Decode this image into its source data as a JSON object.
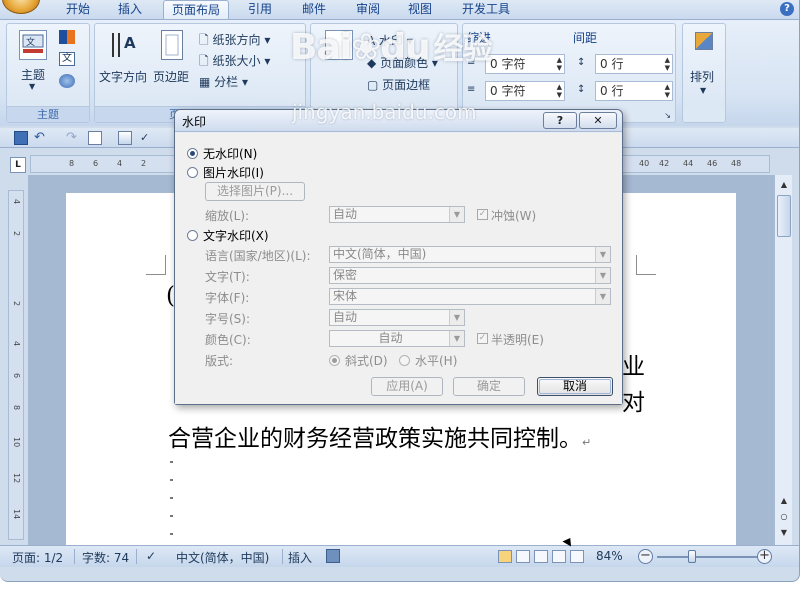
{
  "ribbon_tabs": [
    "开始",
    "插入",
    "页面布局",
    "引用",
    "邮件",
    "审阅",
    "视图",
    "开发工具"
  ],
  "active_tab": "页面布局",
  "theme_group": {
    "label": "主题",
    "theme_button": "主题"
  },
  "page_setup": {
    "text_direction": "文字方向",
    "margins": "页边距",
    "orientation": "纸张方向",
    "size": "纸张大小",
    "columns": "分栏",
    "group_label": "页"
  },
  "page_background": {
    "watermark": "水印",
    "page_color": "页面颜色",
    "page_border": "页面边框"
  },
  "paragraph": {
    "indent_title": "缩进",
    "spacing_title": "间距",
    "indent_left": "0 字符",
    "indent_right": "0 字符",
    "spacing_before": "0 行",
    "spacing_after": "0 行"
  },
  "arrange": {
    "label": "排列"
  },
  "ruler": {
    "h_numbers": [
      "8",
      "6",
      "4",
      "2",
      "40",
      "42",
      "44",
      "46",
      "48"
    ],
    "v_numbers": [
      "4",
      "2",
      "2",
      "4",
      "6",
      "8",
      "10",
      "12",
      "14"
    ],
    "corner": "L"
  },
  "document": {
    "line1_char": "业",
    "line2_char": "对",
    "line3": "合营企业的财务经营政策实施共同控制。",
    "para_mark": "↵",
    "left_mark_1": "("
  },
  "dialog": {
    "title": "水印",
    "help_btn": "?",
    "close_btn": "✕",
    "no_watermark": "无水印(N)",
    "picture_watermark": "图片水印(I)",
    "select_picture": "选择图片(P)...",
    "scale_label": "缩放(L):",
    "scale_value": "自动",
    "washout_label": "冲蚀(W)",
    "text_watermark": "文字水印(X)",
    "language_label": "语言(国家/地区)(L):",
    "language_value": "中文(简体，中国)",
    "text_label": "文字(T):",
    "text_value": "保密",
    "font_label": "字体(F):",
    "font_value": "宋体",
    "size_label": "字号(S):",
    "size_value": "自动",
    "color_label": "颜色(C):",
    "color_value": "自动",
    "semitransparent_label": "半透明(E)",
    "layout_label": "版式:",
    "diagonal_label": "斜式(D)",
    "horizontal_label": "水平(H)",
    "apply_btn": "应用(A)",
    "ok_btn": "确定",
    "cancel_btn": "取消"
  },
  "status_bar": {
    "page": "页面: 1/2",
    "words": "字数: 74",
    "language": "中文(简体，中国)",
    "mode": "插入",
    "zoom": "84%"
  },
  "watermark_overlay": {
    "brand": "Bai",
    "brand2": "du",
    "cn": "经验",
    "url": "jingyan.baidu.com"
  },
  "colors": {
    "ribbon_bg": "#dbe6f4",
    "accent": "#15428b",
    "doc_area_bg": "#a5b9d3"
  }
}
